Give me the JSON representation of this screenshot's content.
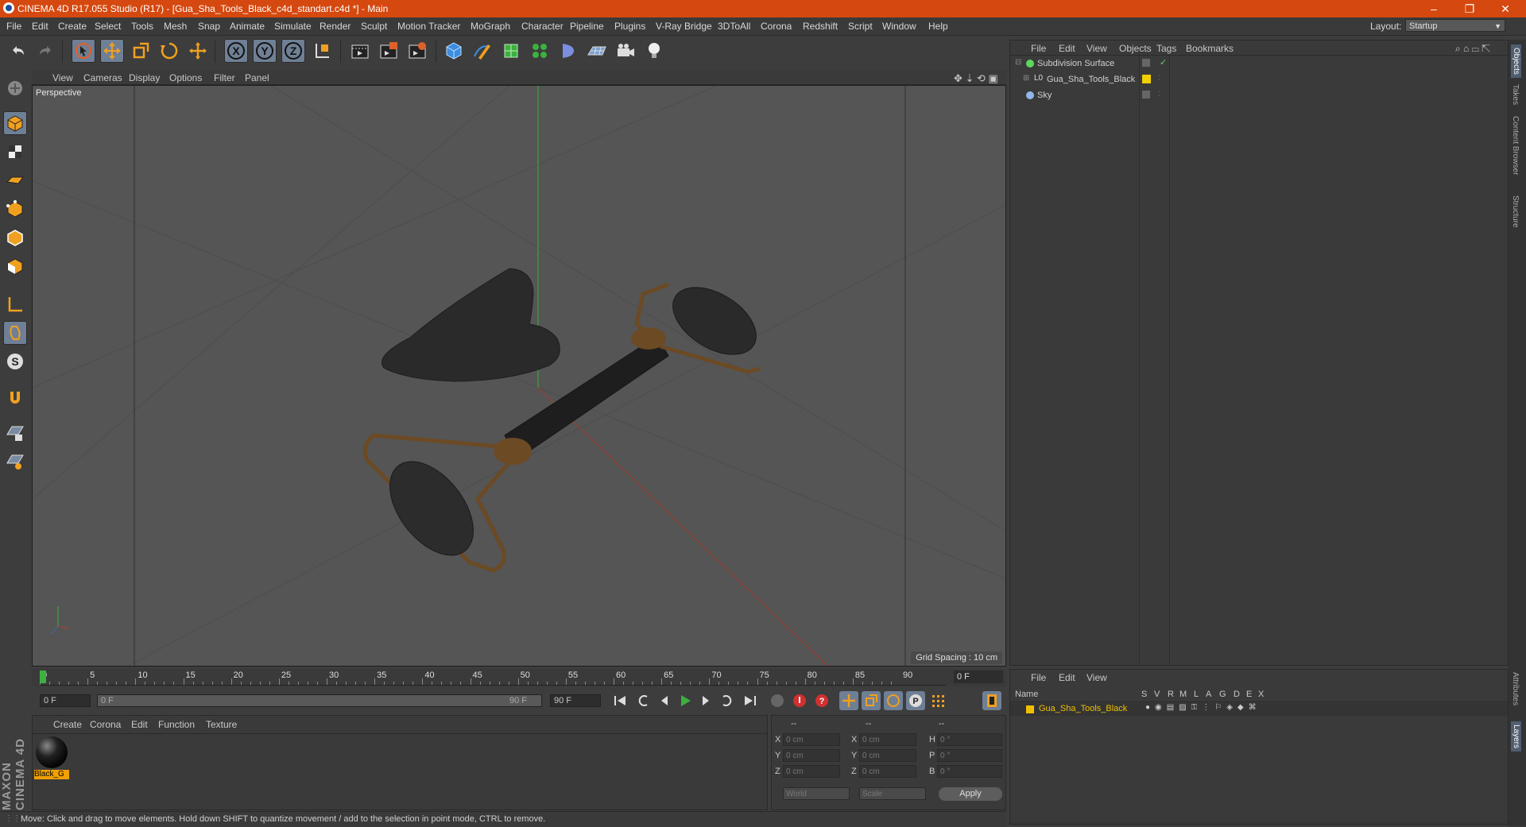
{
  "window": {
    "title": "CINEMA 4D R17.055 Studio (R17) - [Gua_Sha_Tools_Black_c4d_standart.c4d *] - Main",
    "controls": [
      "–",
      "❐",
      "✕"
    ]
  },
  "menubar": {
    "items": [
      "File",
      "Edit",
      "Create",
      "Select",
      "Tools",
      "Mesh",
      "Snap",
      "Animate",
      "Simulate",
      "Render",
      "Sculpt",
      "Motion Tracker",
      "MoGraph",
      "Character",
      "Pipeline",
      "Plugins",
      "V-Ray Bridge",
      "3DToAll",
      "Corona",
      "Redshift",
      "Script",
      "Window",
      "Help"
    ],
    "layout_label": "Layout:",
    "layout_value": "Startup"
  },
  "toolbar": {
    "icons": [
      "undo-icon",
      "redo-icon",
      "select-icon",
      "move-icon",
      "scale-icon",
      "rotate-icon",
      "live-move-icon",
      "x-axis-icon",
      "y-axis-icon",
      "z-axis-icon",
      "coordinate-system-icon",
      "render-view-icon",
      "render-picture-viewer-icon",
      "render-settings-icon",
      "cube-icon",
      "pen-icon",
      "subdivision-icon",
      "cloner-icon",
      "deformer-icon",
      "floor-icon",
      "camera-icon",
      "light-icon"
    ],
    "axis_labels": [
      "X",
      "Y",
      "Z"
    ]
  },
  "viewport": {
    "menu": [
      "View",
      "Cameras",
      "Display",
      "Options",
      "Filter",
      "Panel"
    ],
    "label": "Perspective",
    "grid_spacing": "Grid Spacing : 10 cm",
    "model_color": "#2a2a2a",
    "frame_color": "#6b4a24"
  },
  "object_manager": {
    "menu": [
      "File",
      "Edit",
      "View",
      "Objects",
      "Tags",
      "Bookmarks"
    ],
    "objects": [
      {
        "name": "Subdivision Surface",
        "icon": "subdivision-icon",
        "color": "#5fd65f"
      },
      {
        "name": "Gua_Sha_Tools_Black",
        "icon": "null-object-icon",
        "color": "#f0d000"
      },
      {
        "name": "Sky",
        "icon": "sky-icon",
        "color": "#8fb7e8"
      }
    ]
  },
  "side_tabs": [
    "Objects",
    "Takes",
    "Content Browser",
    "Structure",
    "Attributes",
    "Layers"
  ],
  "layer_manager": {
    "menu": [
      "File",
      "Edit",
      "View"
    ],
    "columns": [
      "Name",
      "S",
      "V",
      "R",
      "M",
      "L",
      "A",
      "G",
      "D",
      "E",
      "X"
    ],
    "layers": [
      {
        "name": "Gua_Sha_Tools_Black",
        "color": "#f0c000"
      }
    ]
  },
  "timeline": {
    "ticks": [
      "0",
      "5",
      "10",
      "15",
      "20",
      "25",
      "30",
      "35",
      "40",
      "45",
      "50",
      "55",
      "60",
      "65",
      "70",
      "75",
      "80",
      "85",
      "90"
    ],
    "current_frame": "0 F",
    "end_frame_box": "0 F"
  },
  "transport": {
    "start_field": "0 F",
    "range_start": "0 F",
    "range_end": "90 F",
    "end_field": "90 F"
  },
  "material_manager": {
    "menu": [
      "Create",
      "Corona",
      "Edit",
      "Function",
      "Texture"
    ],
    "materials": [
      {
        "name": "Black_G"
      }
    ]
  },
  "coordinates": {
    "headers": [
      "--",
      "--",
      "--"
    ],
    "rows": [
      {
        "label1": "X",
        "val1": "0 cm",
        "label2": "X",
        "val2": "0 cm",
        "label3": "H",
        "val3": "0 °"
      },
      {
        "label1": "Y",
        "val1": "0 cm",
        "label2": "Y",
        "val2": "0 cm",
        "label3": "P",
        "val3": "0 °"
      },
      {
        "label1": "Z",
        "val1": "0 cm",
        "label2": "Z",
        "val2": "0 cm",
        "label3": "B",
        "val3": "0 °"
      }
    ],
    "world": "World",
    "scale": "Scale",
    "apply": "Apply"
  },
  "status": {
    "text": "Move: Click and drag to move elements. Hold down SHIFT to quantize movement / add to the selection in point mode, CTRL to remove."
  },
  "brand": "MAXON CINEMA 4D"
}
